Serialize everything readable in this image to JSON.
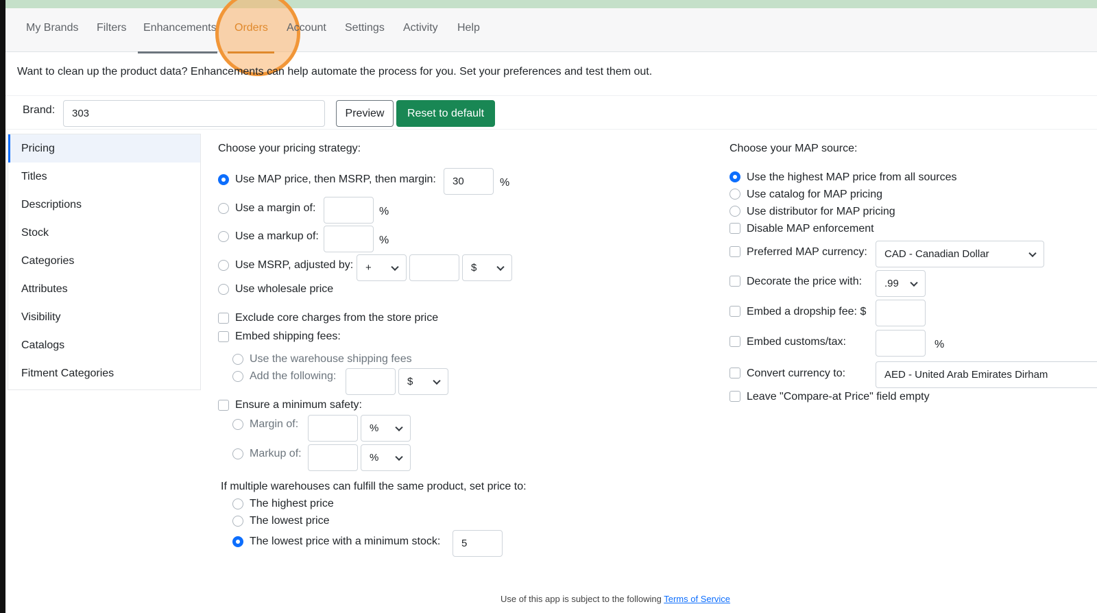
{
  "nav": {
    "tabs": [
      "My Brands",
      "Filters",
      "Enhancements",
      "Orders",
      "Account",
      "Settings",
      "Activity",
      "Help"
    ]
  },
  "intro": "Want to clean up the product data? Enhancements can help automate the process for you. Set your preferences and test them out.",
  "brand": {
    "label": "Brand:",
    "value": "303",
    "preview": "Preview",
    "reset": "Reset to default"
  },
  "sidebar": {
    "items": [
      "Pricing",
      "Titles",
      "Descriptions",
      "Stock",
      "Categories",
      "Attributes",
      "Visibility",
      "Catalogs",
      "Fitment Categories"
    ],
    "active": "Pricing"
  },
  "pricing": {
    "heading": "Choose your pricing strategy:",
    "opt_map": "Use MAP price, then MSRP, then margin:",
    "map_margin": "30",
    "pct": "%",
    "opt_margin": "Use a margin of:",
    "opt_markup": "Use a markup of:",
    "opt_msrp": "Use MSRP, adjusted by:",
    "msrp_op": "+",
    "msrp_unit": "$",
    "opt_wholesale": "Use wholesale price",
    "exclude_core": "Exclude core charges from the store price",
    "embed_shipping": "Embed shipping fees:",
    "ship_warehouse": "Use the warehouse shipping fees",
    "ship_add": "Add the following:",
    "ship_unit": "$",
    "min_safety": "Ensure a minimum safety:",
    "safety_margin": "Margin of:",
    "safety_markup": "Markup of:",
    "safety_margin_unit": "%",
    "safety_markup_unit": "%",
    "multi_heading": "If multiple warehouses can fulfill the same product, set price to:",
    "multi_highest": "The highest price",
    "multi_lowest": "The lowest price",
    "multi_lowest_stock": "The lowest price with a minimum stock:",
    "min_stock": "5"
  },
  "map": {
    "heading": "Choose your MAP source:",
    "opt_highest": "Use the highest MAP price from all sources",
    "opt_catalog": "Use catalog for MAP pricing",
    "opt_distributor": "Use distributor for MAP pricing",
    "disable": "Disable MAP enforcement",
    "pref_currency": "Preferred MAP currency:",
    "pref_currency_value": "CAD - Canadian Dollar",
    "decorate": "Decorate the price with:",
    "decorate_value": ".99",
    "dropship": "Embed a dropship fee: $",
    "customs": "Embed customs/tax:",
    "customs_unit": "%",
    "convert": "Convert currency to:",
    "convert_value": "AED - United Arab Emirates Dirham",
    "leave_compare": "Leave \"Compare-at Price\" field empty"
  },
  "footer": {
    "text": "Use of this app is subject to the following ",
    "link": "Terms of Service"
  }
}
